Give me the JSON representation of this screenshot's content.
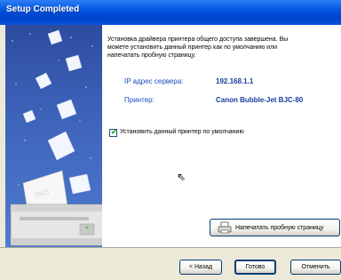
{
  "window": {
    "title": "Setup Completed"
  },
  "content": {
    "intro_line1": "Установка драйвера принтера общего доступа завершена. Вы",
    "intro_line2": "можете установить данный принтер как по умолчанию или",
    "intro_line3": "напечатать пробную страницу.",
    "server_label": "IP адрес сервера:",
    "server_value": "192.168.1.1",
    "printer_label": "Принтер:",
    "printer_value": "Canon Bubble-Jet BJC-80",
    "default_checkbox_label": "Установить данный принтер по умолчанию",
    "default_checkbox_checked": true
  },
  "buttons": {
    "print_test": "Напечатать пробную страницу",
    "back": "< Назад",
    "finish": "Готово",
    "cancel": "Отменить"
  },
  "colors": {
    "titlebar": "#0049d4",
    "label_blue": "#1b4bbf",
    "value_blue": "#173e9c",
    "dialog_bg": "#ece9d8"
  },
  "icons": {
    "printer_artwork": "printer-icon",
    "print_button_icon": "printer-icon",
    "check": "checkmark-icon",
    "cursor": "mouse-cursor-icon"
  }
}
